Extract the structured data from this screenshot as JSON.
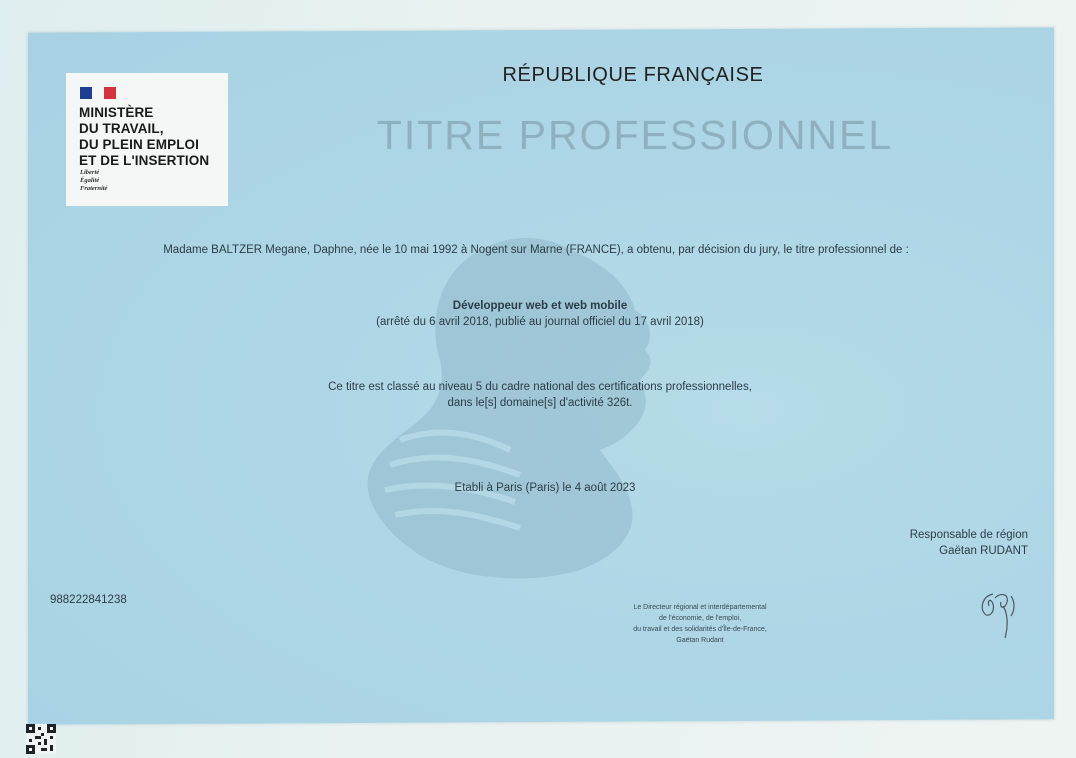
{
  "header": {
    "logo": {
      "ministry_lines": [
        "MINISTÈRE",
        "DU TRAVAIL,",
        "DU PLEIN EMPLOI",
        "ET DE L'INSERTION"
      ],
      "motto_lines": [
        "Liberté",
        "Égalité",
        "Fraternité"
      ],
      "flag_colors": [
        "#1e3f8f",
        "#f5f7f7",
        "#d2333c"
      ]
    },
    "republique": "RÉPUBLIQUE FRANÇAISE",
    "title": "TITRE PROFESSIONNEL"
  },
  "body": {
    "intro": "Madame BALTZER Megane, Daphne, née le 10 mai 1992 à Nogent sur Marne (FRANCE), a obtenu, par décision du jury, le titre professionnel de :",
    "diploma_name": "Développeur web et web mobile",
    "decree": "(arrêté du 6 avril 2018, publié au journal officiel du 17 avril 2018)",
    "level_line1": "Ce titre est classé au niveau 5 du cadre national des certifications professionnelles,",
    "level_line2": "dans le[s] domaine[s] d'activité 326t.",
    "established": "Etabli à Paris (Paris) le 4 août 2023"
  },
  "signatory": {
    "role": "Responsable de région",
    "name": "Gaëtan RUDANT"
  },
  "footer": {
    "serial": "988222841238",
    "stamp_lines": [
      "Le Directeur régional et interdépartemental",
      "de l'économie, de l'emploi,",
      "du travail et des solidarités d'Île-de-France,",
      "Gaëtan Rudant"
    ]
  }
}
